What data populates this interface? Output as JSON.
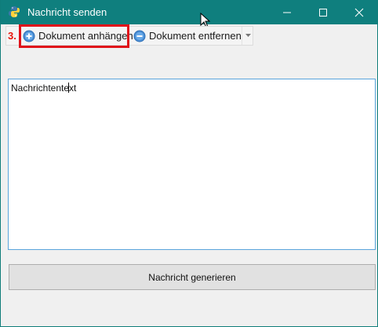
{
  "window": {
    "title": "Nachricht senden",
    "controls": {
      "minimize": "minimize-icon",
      "maximize": "maximize-icon",
      "close": "close-icon"
    }
  },
  "toolbar": {
    "step_label": "3.",
    "attach_label": "Dokument anhängen",
    "remove_label": "Dokument entfernen",
    "attach_icon": "add-circle-icon",
    "remove_icon": "remove-circle-icon"
  },
  "message": {
    "text": "Nachrichtentext"
  },
  "actions": {
    "generate_label": "Nachricht generieren"
  },
  "colors": {
    "titlebar": "#0f7f7e",
    "highlight": "#e0121a",
    "focus_border": "#5aa5dc"
  }
}
